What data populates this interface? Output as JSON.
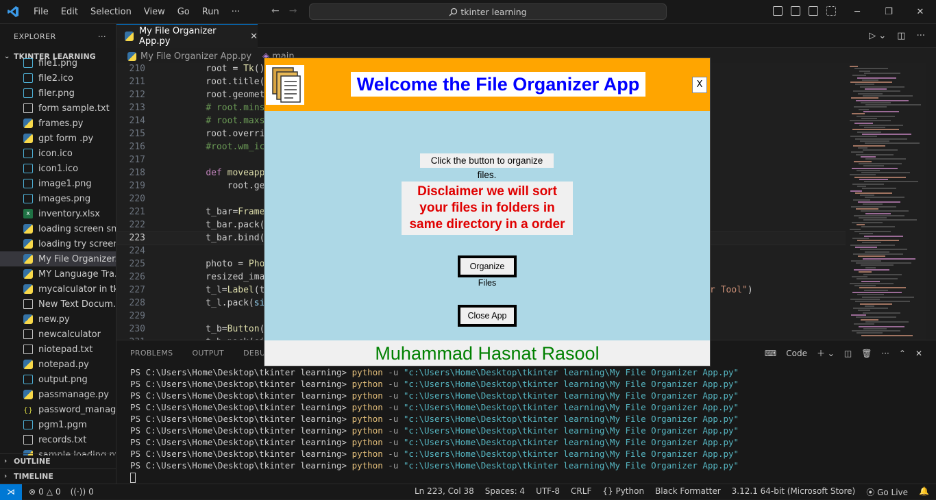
{
  "titlebar": {
    "menu": [
      "File",
      "Edit",
      "Selection",
      "View",
      "Go",
      "Run",
      "···"
    ],
    "search": "tkinter learning"
  },
  "sidebar": {
    "title": "EXPLORER",
    "more": "···",
    "root_folder": "TKINTER LEARNING",
    "files": [
      {
        "name": "file1.png",
        "type": "img"
      },
      {
        "name": "file2.ico",
        "type": "img"
      },
      {
        "name": "filer.png",
        "type": "img"
      },
      {
        "name": "form sample.txt",
        "type": "txt"
      },
      {
        "name": "frames.py",
        "type": "py"
      },
      {
        "name": "gpt form .py",
        "type": "py"
      },
      {
        "name": "icon.ico",
        "type": "img"
      },
      {
        "name": "icon1.ico",
        "type": "img"
      },
      {
        "name": "image1.png",
        "type": "img"
      },
      {
        "name": "images.png",
        "type": "img"
      },
      {
        "name": "inventory.xlsx",
        "type": "xl"
      },
      {
        "name": "loading screen sni...",
        "type": "py"
      },
      {
        "name": "loading try screen...",
        "type": "py"
      },
      {
        "name": "My File Organizer...",
        "type": "py",
        "active": true
      },
      {
        "name": "MY Language Tra...",
        "type": "py"
      },
      {
        "name": "mycalculator in tk...",
        "type": "py"
      },
      {
        "name": "New Text Docum...",
        "type": "txt"
      },
      {
        "name": "new.py",
        "type": "py"
      },
      {
        "name": "newcalculator",
        "type": "txt"
      },
      {
        "name": "niotepad.txt",
        "type": "txt"
      },
      {
        "name": "notepad.py",
        "type": "py"
      },
      {
        "name": "output.png",
        "type": "img"
      },
      {
        "name": "passmanage.py",
        "type": "py"
      },
      {
        "name": "password_manag...",
        "type": "json"
      },
      {
        "name": "pgm1.pgm",
        "type": "img"
      },
      {
        "name": "records.txt",
        "type": "txt"
      },
      {
        "name": "sample loading.py",
        "type": "py"
      }
    ],
    "outline": "OUTLINE",
    "timeline": "TIMELINE"
  },
  "editor": {
    "tab": "My File Organizer App.py",
    "tab_close": "✕",
    "breadcrumb_file": "My File Organizer App.py",
    "breadcrumb_symbol": "main",
    "current_line": 223,
    "lines": [
      {
        "n": "210",
        "html": "    root = <span class='fn'>Tk</span>()"
      },
      {
        "n": "211",
        "html": "    root.title(<span class='str'>\"File</span>"
      },
      {
        "n": "212",
        "html": "    root.geometry(<span class='str'>\"</span>"
      },
      {
        "n": "213",
        "html": "    <span class='cm'># root.minsize(</span>"
      },
      {
        "n": "214",
        "html": "    <span class='cm'># root.maxsize(</span>"
      },
      {
        "n": "215",
        "html": "    root.overrideredi"
      },
      {
        "n": "216",
        "html": "    <span class='cm'>#root.wm_iconbit</span>"
      },
      {
        "n": "217",
        "html": ""
      },
      {
        "n": "218",
        "html": "    <span class='kw'>def</span> <span class='fn'>moveapp</span>(<span class='var'>e</span>):"
      },
      {
        "n": "219",
        "html": "        root.geomet"
      },
      {
        "n": "220",
        "html": ""
      },
      {
        "n": "221",
        "html": "    t_bar=<span class='fn'>Frame</span>(root"
      },
      {
        "n": "222",
        "html": "    t_bar.pack(<span class='var'>fill</span>"
      },
      {
        "n": "223",
        "html": "    t_bar.bind(<span class='str'>\"&lt;B1</span>"
      },
      {
        "n": "224",
        "html": ""
      },
      {
        "n": "225",
        "html": "    photo = <span class='fn'>PhotoIma</span>                                                                           <span class='str'>les</span>"
      },
      {
        "n": "226",
        "html": "    resized_image=ph"
      },
      {
        "n": "227",
        "html": "    t_l=<span class='fn'>Label</span>(t_bar                                                                          <span class='str'>anzier Tool\"</span>)"
      },
      {
        "n": "228",
        "html": "    t_l.pack(<span class='var'>side</span>=<span class='var'>LE</span>"
      },
      {
        "n": "229",
        "html": ""
      },
      {
        "n": "230",
        "html": "    t_b=<span class='fn'>Button</span>(t_bar"
      },
      {
        "n": "231",
        "html": "    t_b.pack(side=L"
      }
    ]
  },
  "panel": {
    "tabs": [
      "PROBLEMS",
      "OUTPUT",
      "DEBUG CONSOLE"
    ],
    "shell_label": "Code",
    "prompt": "PS C:\\Users\\Home\\Desktop\\tkinter learning>",
    "command": "python",
    "flag": "-u",
    "path": "\"c:\\Users\\Home\\Desktop\\tkinter learning\\My File Organizer App.py\"",
    "repeat": 9
  },
  "statusbar": {
    "errors": "0",
    "warnings": "0",
    "ports": "0",
    "position": "Ln 223, Col 38",
    "spaces": "Spaces: 4",
    "encoding": "UTF-8",
    "eol": "CRLF",
    "language": "Python",
    "formatter": "Black Formatter",
    "interpreter": "3.12.1 64-bit (Microsoft Store)",
    "golive": "Go Live"
  },
  "app": {
    "title": "Welcome the File Organizer App",
    "close_x": "X",
    "instruction": "Click the button to organize files.",
    "disclaimer": "Disclaimer we will sort your files in folders in same directory in a order",
    "organize_button": "Organize Files",
    "close_button": "Close App",
    "footer": "Muhammad Hasnat Rasool",
    "colors": {
      "header": "#ffa500",
      "body": "#add8e6",
      "title": "#0000ff",
      "disclaimer": "#e00000",
      "footer": "#008000"
    }
  }
}
